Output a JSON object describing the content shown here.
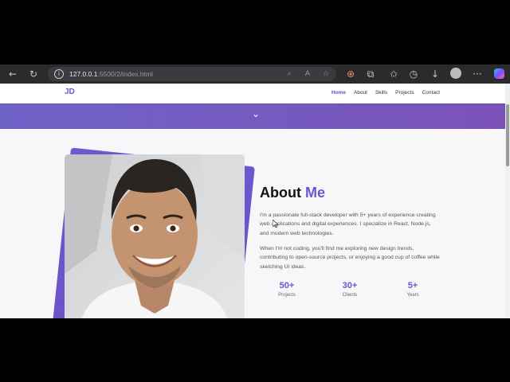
{
  "browser": {
    "url_prefix": "127.0.0.1",
    "url_rest": ":5500/2/index.html",
    "icons": [
      "back-icon",
      "refresh-icon",
      "info-icon",
      "zoom-icon",
      "read-aloud-icon",
      "favorite-icon",
      "extension-icon",
      "puzzle-icon",
      "collections-icon",
      "history-icon",
      "downloads-icon",
      "profile-icon",
      "more-icon",
      "copilot-icon"
    ]
  },
  "site": {
    "logo": "JD",
    "nav": [
      "Home",
      "About",
      "Skills",
      "Projects",
      "Contact"
    ],
    "active_nav": "Home",
    "accent_color": "#6b55c9"
  },
  "about": {
    "title_a": "About",
    "title_b": "Me",
    "paragraph1": "I'm a passionate full-stack developer with 5+ years of experience creating web applications and digital experiences. I specialize in React, Node.js, and modern web technologies.",
    "paragraph2": "When I'm not coding, you'll find me exploring new design trends, contributing to open-source projects, or enjoying a good cup of coffee while sketching UI ideas.",
    "stats": [
      {
        "value": "50+",
        "label": "Projects"
      },
      {
        "value": "30+",
        "label": "Clients"
      },
      {
        "value": "5+",
        "label": "Years"
      }
    ]
  }
}
